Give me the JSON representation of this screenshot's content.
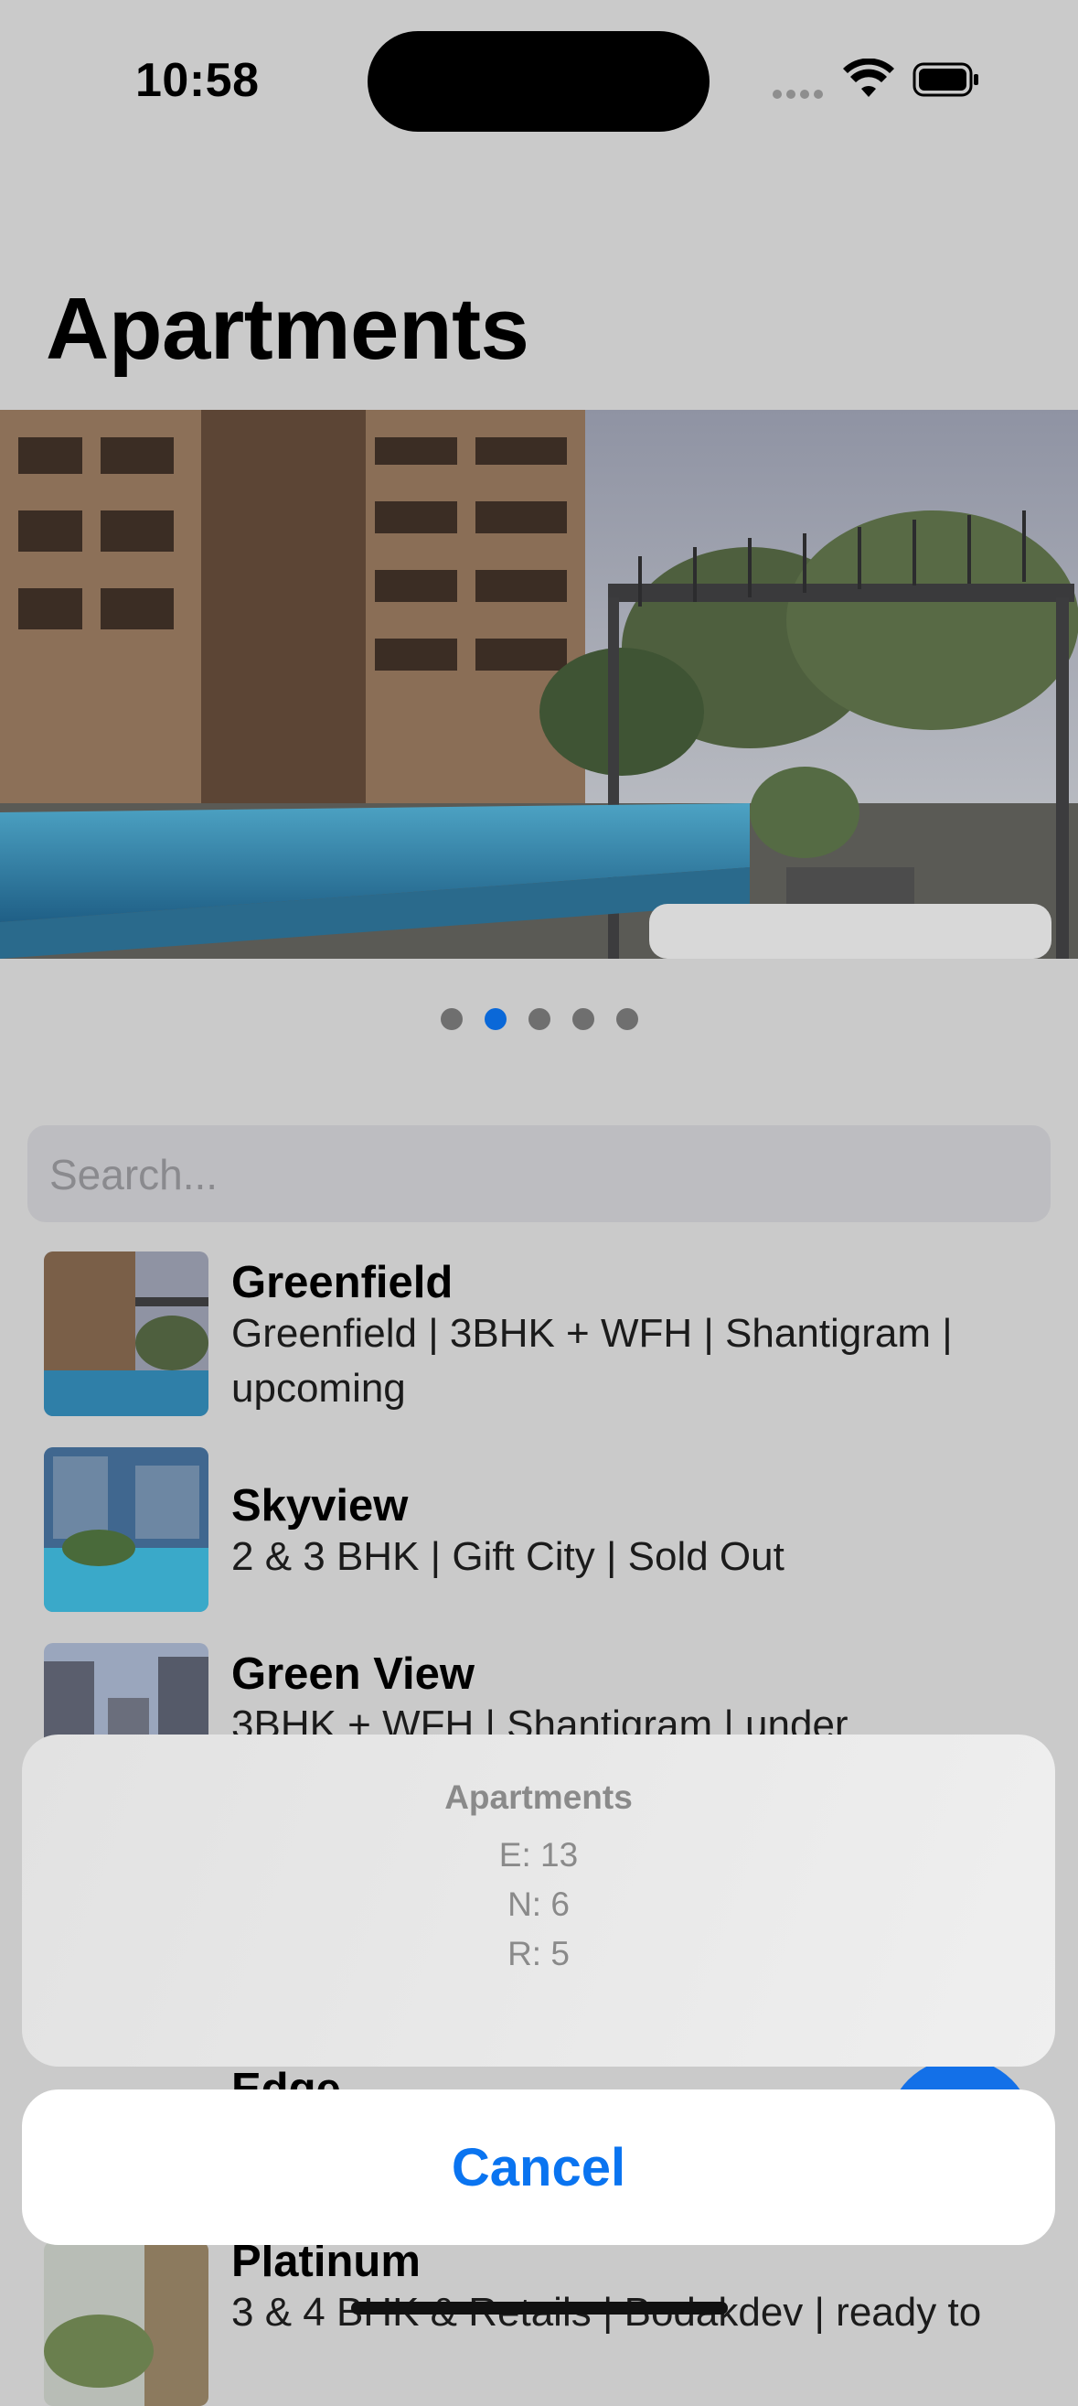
{
  "status_bar": {
    "time": "10:58"
  },
  "page_title": "Apartments",
  "carousel": {
    "page_count": 5,
    "active_index": 1
  },
  "search": {
    "placeholder": "Search..."
  },
  "apartments": [
    {
      "name": "Greenfield",
      "details": "Greenfield | 3BHK + WFH | Shantigram | upcoming"
    },
    {
      "name": "Skyview",
      "details": "2 & 3 BHK | Gift City | Sold Out"
    },
    {
      "name": "Green View",
      "details": "3BHK + WFH | Shantigram | under"
    },
    {
      "name": "Edge",
      "details": ""
    },
    {
      "name": "Platinum",
      "details": "3 & 4 BHK & Retails | Bodakdev | ready to"
    }
  ],
  "action_sheet": {
    "title": "Apartments",
    "lines": [
      "E: 13",
      "N: 6",
      "R: 5"
    ],
    "cancel_label": "Cancel"
  },
  "colors": {
    "accent": "#0a74f0",
    "page_dot_active": "#0a68d8",
    "background": "#cacaca"
  }
}
